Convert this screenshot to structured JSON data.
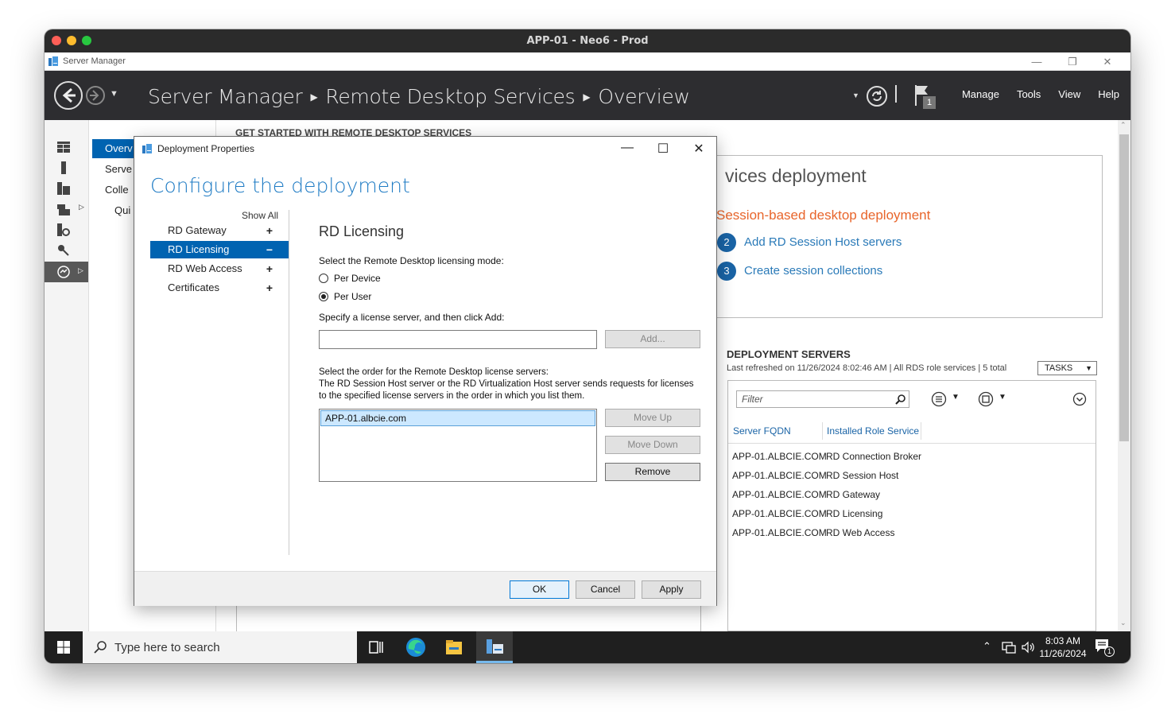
{
  "mac": {
    "title": "APP-01 - Neo6 - Prod"
  },
  "window": {
    "title": "Server Manager"
  },
  "header": {
    "breadcrumb": [
      "Server Manager",
      "Remote Desktop Services",
      "Overview"
    ],
    "flag_count": "1",
    "menu": [
      "Manage",
      "Tools",
      "View",
      "Help"
    ]
  },
  "nav": {
    "items": [
      "Overv",
      "Serve",
      "Colle",
      "Qui"
    ]
  },
  "main": {
    "get_started": "GET STARTED WITH REMOTE DESKTOP SERVICES",
    "rds_title": "vices deployment",
    "session_title": "Session-based desktop deployment",
    "steps": [
      {
        "num": "2",
        "label": "Add RD Session Host servers"
      },
      {
        "num": "3",
        "label": "Create session collections"
      }
    ]
  },
  "deployment_servers": {
    "title": "DEPLOYMENT SERVERS",
    "subtitle": "Last refreshed on 11/26/2024 8:02:46 AM | All RDS role services | 5 total",
    "tasks_label": "TASKS",
    "filter_placeholder": "Filter",
    "columns": [
      "Server FQDN",
      "Installed Role Service"
    ],
    "rows": [
      {
        "fqdn": "APP-01.ALBCIE.COM",
        "role": "RD Connection Broker"
      },
      {
        "fqdn": "APP-01.ALBCIE.COM",
        "role": "RD Session Host"
      },
      {
        "fqdn": "APP-01.ALBCIE.COM",
        "role": "RD Gateway"
      },
      {
        "fqdn": "APP-01.ALBCIE.COM",
        "role": "RD Licensing"
      },
      {
        "fqdn": "APP-01.ALBCIE.COM",
        "role": "RD Web Access"
      }
    ]
  },
  "dialog": {
    "title": "Deployment Properties",
    "heading": "Configure the deployment",
    "show_all": "Show All",
    "nav": [
      {
        "label": "RD Gateway",
        "sign": "+"
      },
      {
        "label": "RD Licensing",
        "sign": "−",
        "selected": true
      },
      {
        "label": "RD Web Access",
        "sign": "+"
      },
      {
        "label": "Certificates",
        "sign": "+"
      }
    ],
    "section_title": "RD Licensing",
    "mode_label": "Select the Remote Desktop licensing mode:",
    "modes": [
      {
        "label": "Per Device",
        "checked": false
      },
      {
        "label": "Per User",
        "checked": true
      }
    ],
    "server_label": "Specify a license server, and then click Add:",
    "server_input_value": "",
    "add_button": "Add...",
    "order_label_1": "Select the order for the Remote Desktop license servers:",
    "order_label_2": "The RD Session Host server or the RD Virtualization Host server sends requests for licenses",
    "order_label_3": "to the specified license servers in the order in which you list them.",
    "license_servers": [
      "APP-01.albcie.com"
    ],
    "move_up": "Move Up",
    "move_down": "Move Down",
    "remove": "Remove",
    "ok": "OK",
    "cancel": "Cancel",
    "apply": "Apply"
  },
  "taskbar": {
    "search_placeholder": "Type here to search",
    "time": "8:03 AM",
    "date": "11/26/2024",
    "notification_count": "1"
  },
  "colors": {
    "accent": "#0063b1",
    "heading_blue": "#1e7bc4",
    "orange": "#e8652b",
    "header_bg": "#2d2d30"
  }
}
